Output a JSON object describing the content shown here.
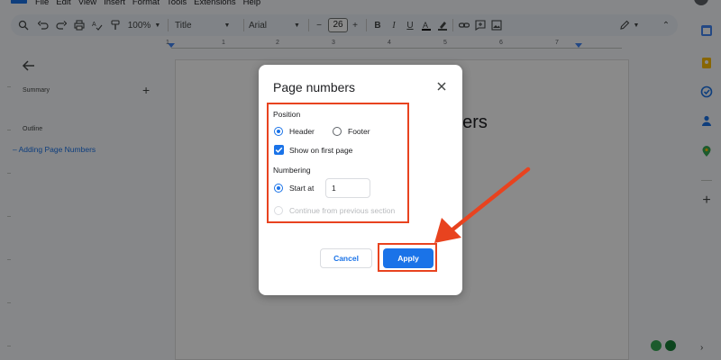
{
  "menubar": {
    "items": [
      "File",
      "Edit",
      "View",
      "Insert",
      "Format",
      "Tools",
      "Extensions",
      "Help"
    ]
  },
  "toolbar": {
    "zoom": "100%",
    "style": "Title",
    "font": "Arial",
    "font_size": "26"
  },
  "ruler": {
    "numbers": [
      "1",
      "1",
      "2",
      "3",
      "4",
      "5",
      "6",
      "7"
    ]
  },
  "left_panel": {
    "summary_label": "Summary",
    "outline_label": "Outline",
    "outline_items": [
      "Adding Page Numbers"
    ]
  },
  "document": {
    "title_fragment": "bers"
  },
  "dialog": {
    "title": "Page numbers",
    "position_heading": "Position",
    "header_label": "Header",
    "footer_label": "Footer",
    "show_first_page_label": "Show on first page",
    "numbering_heading": "Numbering",
    "start_at_label": "Start at",
    "start_at_value": "1",
    "continue_label": "Continue from previous section",
    "cancel_label": "Cancel",
    "apply_label": "Apply",
    "position_selected": "Header",
    "numbering_selected": "Start at",
    "show_first_page_checked": true
  },
  "colors": {
    "accent": "#1a73e8",
    "annotation": "#e8431f",
    "overlay": "rgba(0,0,0,0.46)"
  }
}
